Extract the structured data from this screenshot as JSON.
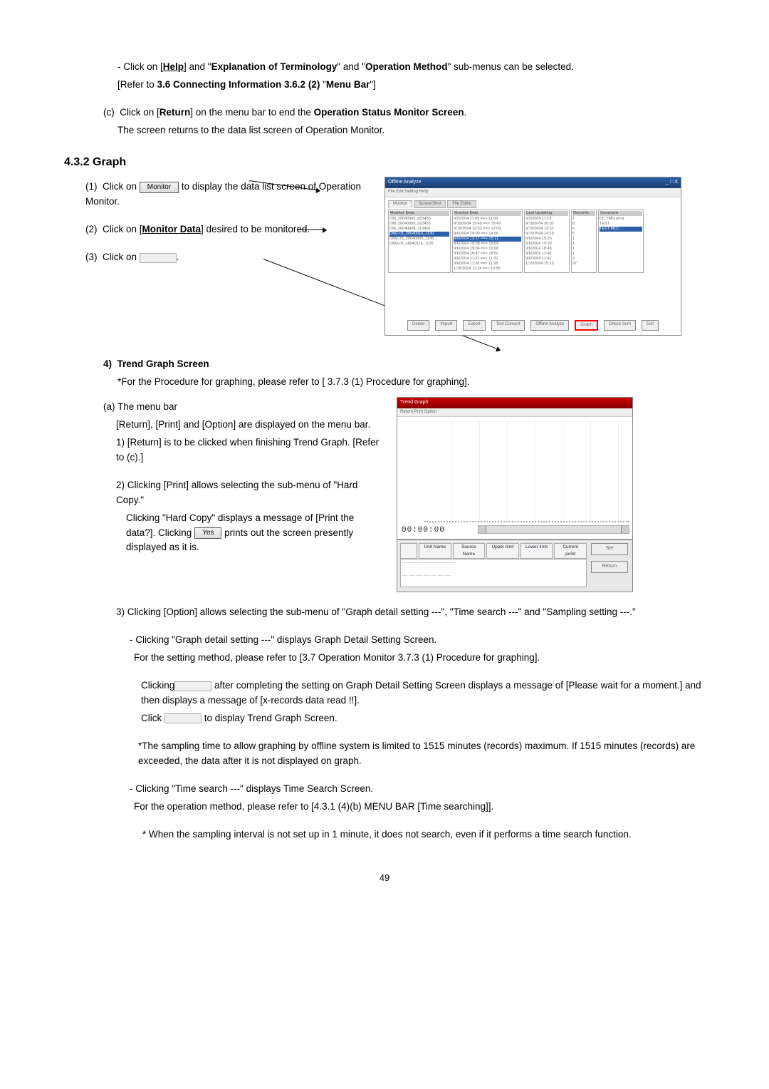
{
  "top": {
    "help_line_pre": "- Click on [",
    "help_word": "Help",
    "help_line_mid1": "] and \"",
    "term_word": "Explanation of Terminology",
    "help_line_mid2": "\" and \"",
    "opmethod_word": "Operation Method",
    "help_line_post": "\" sub-menus can be selected.",
    "refer_line": "[Refer to 3.6 Connecting Information 3.6.2 (2) \"Menu Bar\"]",
    "c_label": "(c)",
    "c_pre": "Click on [",
    "return_word": "Return",
    "c_mid": "] on the menu bar to end the ",
    "opstat_word": "Operation Status Monitor Screen",
    "c_post": ".",
    "c_line2": "The screen returns to the data list screen of Operation Monitor."
  },
  "section": "4.3.2 Graph",
  "steps": {
    "s1_label": "(1)",
    "s1_pre": "Click on ",
    "s1_btn": "Monitor",
    "s1_post": " to display the data list screen of Operation Monitor.",
    "s2_label": "(2)",
    "s2_pre": "Click on [",
    "s2_link": "Monitor Data",
    "s2_post": "] desired to be monitored.",
    "s3_label": "(3)",
    "s3_pre": "Click on ",
    "s3_post": "."
  },
  "ss1": {
    "title": "Offline Analyze",
    "win_ctrl": "_ □ X",
    "menubar": "File   Edit   Setting   Help",
    "tab1": "Monitor",
    "tab_screenshot": "ScreenShot",
    "tab_fileeditor": "File Editor",
    "hdr_left": "Monitor Data",
    "hdr_date": "Monitor Date",
    "hdr_last": "Last Updating",
    "hdr_rec": "Records",
    "hdr_com": "Comment",
    "left_rows": [
      "OM_20040906_023456",
      "OM_20040906_023456",
      "OM_20040906_113456",
      "OM1-01_20040916_1130",
      "OM2-25_20040906_1145",
      "OM3-02_sb040116_1130"
    ],
    "date_rows": [
      "9/2/2004 11:05 ==> 11:06",
      "9/19/2004 19:40 ==> 19:49",
      "9/19/2004 13:53 ==> 13:09",
      "9/6/2004 14:00 ==> 14:06",
      "9/6/2004 13:17 ==> 15:11",
      "9/6/2004 19:09 ==> 19:09",
      "9/6/2004 19:06 ==> 19:08",
      "9/6/2004 18:47 ==> 18:50",
      "9/6/2004 11:32 ==> 11:32",
      "9/6/2004 11:28 ==> 11:28",
      "1/15/2004 11:24 ==> 10:56"
    ],
    "last_rows": [
      "9/2/2004 11:19",
      "9/19/2004 20:02",
      "9/19/2004 13:52",
      "9/19/2004 14:19",
      "",
      "9/6/2004 19:20",
      "9/6/2004 19:20",
      "9/6/2004 18:48",
      "9/6/2004 11:46",
      "9/6/2004 11:42",
      "1/15/2004 15:13"
    ],
    "rec_rows": [
      "1",
      "8",
      "6",
      "5",
      "",
      "1",
      "1",
      "1",
      "1",
      "3",
      "97"
    ],
    "com_rows": [
      "",
      "DC TMG error",
      "TEST",
      "",
      "TEST MCC",
      "",
      "",
      "",
      "",
      "",
      ""
    ],
    "buttons": [
      "Delete",
      "Import",
      "Export",
      "Text Convert",
      "Offline Analyze",
      "Graph",
      "Check Sum",
      "Exit"
    ]
  },
  "trend": {
    "heading_num": "4)",
    "heading_text": "Trend Graph Screen",
    "star_line": "*For the Procedure for graphing, please refer to [ 3.7.3 (1) Procedure for graphing].",
    "a_label": "(a) The menu bar",
    "a_line1": "[Return], [Print] and [Option] are displayed on the menu bar.",
    "a_1": "1) [Return] is to be clicked when finishing Trend Graph. [Refer to (c).]",
    "a_2_l1": "2) Clicking [Print] allows selecting the sub-menu of \"Hard Copy.\"",
    "a_2_l2_pre": "Clicking \"Hard Copy\" displays a message of [Print the data?]. Clicking ",
    "a_2_btn": "Yes",
    "a_2_l2_post": " prints out the screen presently displayed as it is.",
    "a_3_l1": "3) Clicking [Option] allows selecting the sub-menu of \"Graph detail setting ---\", \"Time search ---\" and \"Sampling setting ---.\"",
    "gds1": "- Clicking \"Graph detail setting ---\" displays Graph Detail Setting Screen.",
    "gds2": "  For the setting method, please refer to [3.7 Operation Monitor 3.7.3 (1) Procedure for graphing].",
    "gds3_pre": "Clicking",
    "gds3_post": " after completing the setting on Graph Detail Setting Screen displays a message of [Please wait for a moment.] and then displays a message of [x-records data read !!].",
    "gds4_pre": "Click ",
    "gds4_post": " to display Trend Graph Screen.",
    "samp_note": "*The sampling time to allow graphing by offline system is limited to 1515 minutes (records) maximum. If 1515 minutes (records) are exceeded, the data after it is not displayed on graph.",
    "ts1": "- Clicking \"Time search ---\" displays Time Search Screen.",
    "ts2": "  For the operation method, please refer to [4.3.1 (4)(b) MENU BAR [Time searching]].",
    "ts_note": "* When the sampling interval is not set up in 1 minute, it does not search, even if it performs a time search function."
  },
  "ss2": {
    "title": "Trend Graph",
    "menubar": "Return   Print   Option",
    "time": "00:00:00",
    "headers": [
      "Unit Name",
      "Source Name",
      "Upper limit",
      "Lower limit",
      "Current point"
    ],
    "btn_set": "Set",
    "btn_return": "Return"
  },
  "page_number": "49"
}
